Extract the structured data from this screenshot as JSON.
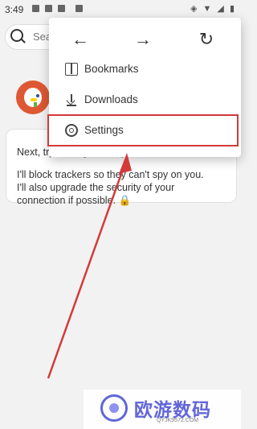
{
  "status_bar": {
    "time": "3:49"
  },
  "search": {
    "placeholder": "Sea"
  },
  "onboarding": {
    "line1": "Next, try visiting one of your favorite sites!",
    "line2": "I'll block trackers so they can't spy on you.",
    "line3": "I'll also upgrade the security of your",
    "line4": "connection if possible. 🔒"
  },
  "menu": {
    "back": "←",
    "forward": "→",
    "refresh": "↻",
    "items": [
      {
        "label": "Bookmarks",
        "icon": "bookmark-icon"
      },
      {
        "label": "Downloads",
        "icon": "download-icon"
      },
      {
        "label": "Settings",
        "icon": "gear-icon"
      }
    ]
  },
  "annotation": {
    "highlight_color": "#d23a3a"
  },
  "watermark": {
    "title": "欧游数码",
    "url": "QYJK9572.COM"
  }
}
